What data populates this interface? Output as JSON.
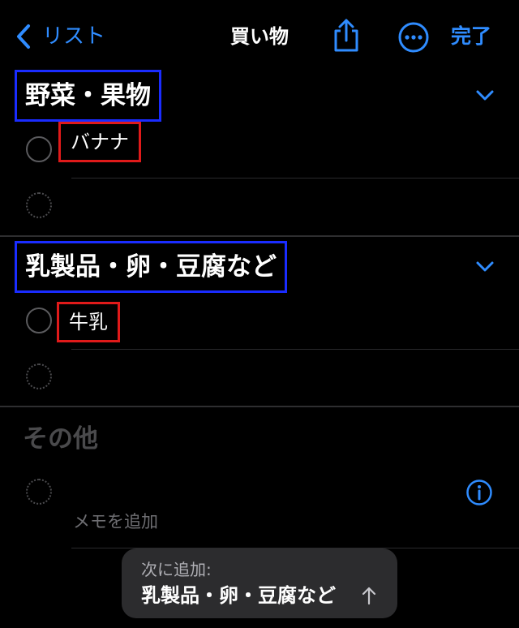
{
  "nav": {
    "back_label": "リスト",
    "title": "買い物",
    "done_label": "完了"
  },
  "sections": [
    {
      "title": "野菜・果物",
      "items": [
        {
          "label": "バナナ"
        }
      ]
    },
    {
      "title": "乳製品・卵・豆腐など",
      "items": [
        {
          "label": "牛乳"
        }
      ]
    },
    {
      "title": "その他",
      "memo_placeholder": "メモを追加"
    }
  ],
  "toast": {
    "caption": "次に追加:",
    "value": "乳製品・卵・豆腐など"
  },
  "colors": {
    "accent": "#2f8cff",
    "section_highlight": "#1a2cff",
    "item_highlight": "#e01a1a",
    "background": "#000000"
  },
  "icons": [
    "back-chevron-icon",
    "share-icon",
    "more-icon",
    "chevron-down-icon",
    "info-icon",
    "arrow-up-icon"
  ]
}
